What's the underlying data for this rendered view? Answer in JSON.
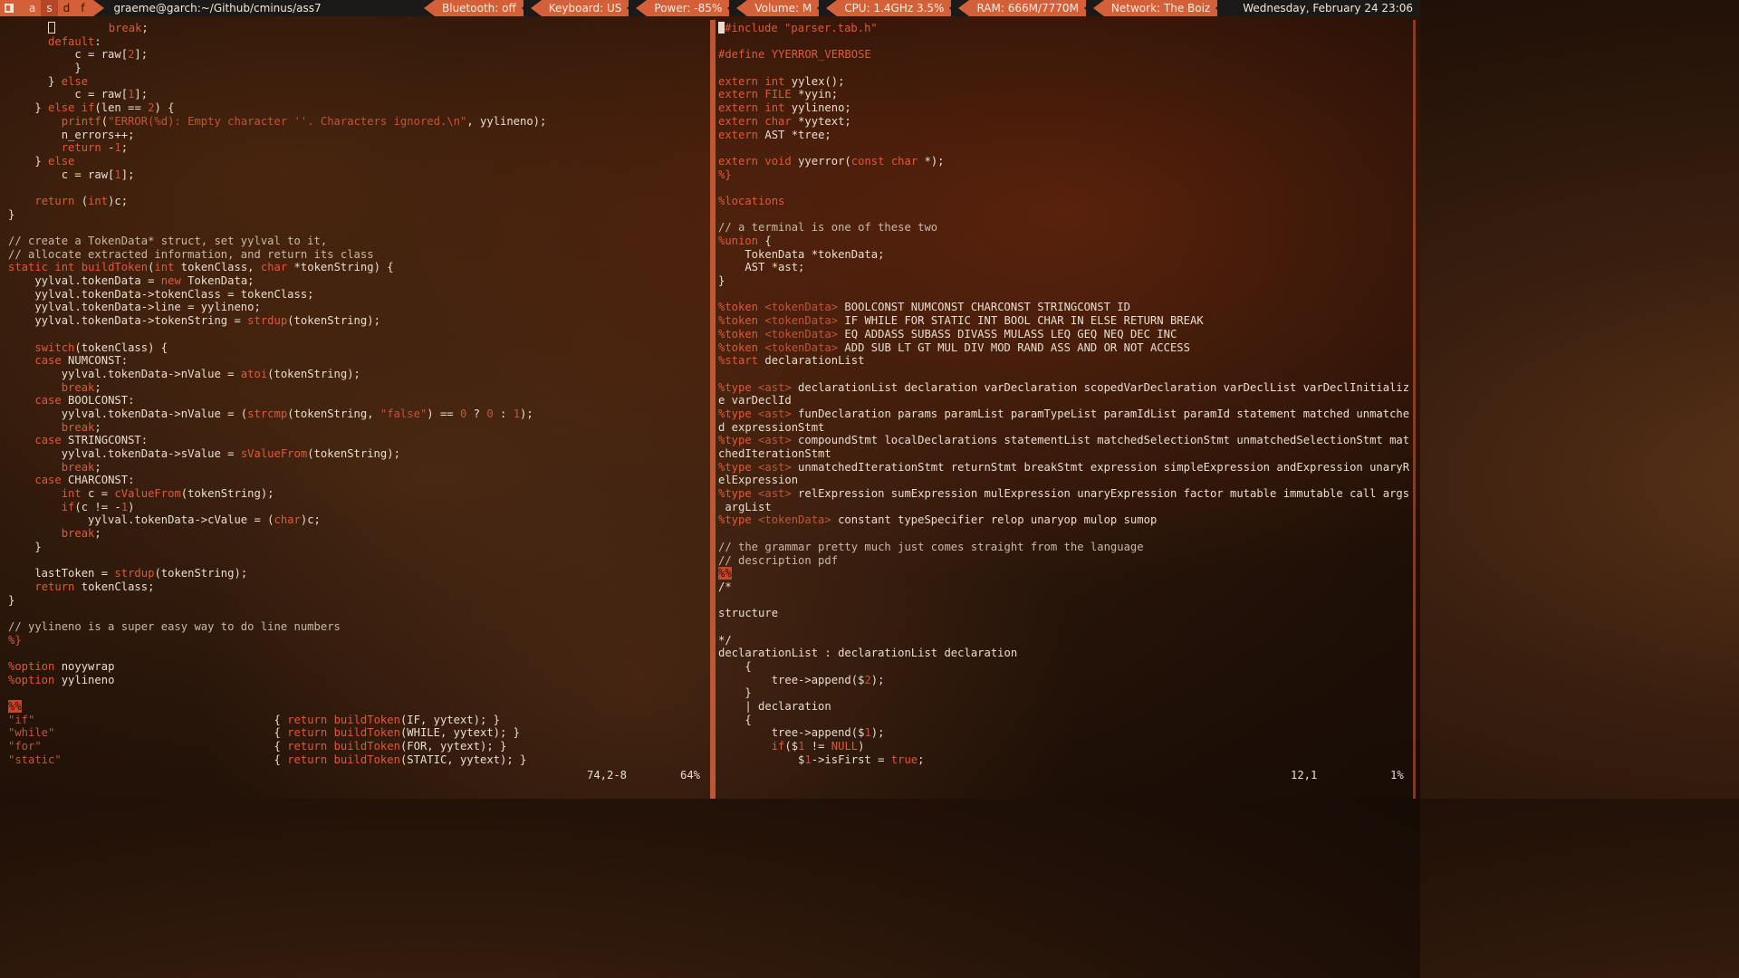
{
  "topbar": {
    "workspaces": [
      "a",
      "s",
      "d",
      "f"
    ],
    "window_title": "graeme@garch:~/Github/cminus/ass7",
    "bluetooth": "Bluetooth: off",
    "keyboard": "Keyboard: US",
    "power": "Power: -85%",
    "volume": "Volume: M",
    "cpu": "CPU: 1.4GHz 3.5%",
    "ram": "RAM: 666M/7770M",
    "network": "Network: The Boiz",
    "datetime": "Wednesday, February 24 23:06"
  },
  "accent_color": "#d4603a",
  "left_pane": {
    "lines": [
      "        break;",
      "      default:",
      "          c = raw[2];",
      "          }",
      "      } else",
      "          c = raw[1];",
      "    } else if(len == 2) {",
      "        printf(\"ERROR(%d): Empty character ''. Characters ignored.\\n\", yylineno);",
      "        n_errors++;",
      "        return -1;",
      "    } else",
      "        c = raw[1];",
      "",
      "    return (int)c;",
      "}",
      "",
      "// create a TokenData* struct, set yylval to it,",
      "// allocate extracted information, and return its class",
      "static int buildToken(int tokenClass, char *tokenString) {",
      "    yylval.tokenData = new TokenData;",
      "    yylval.tokenData->tokenClass = tokenClass;",
      "    yylval.tokenData->line = yylineno;",
      "    yylval.tokenData->tokenString = strdup(tokenString);",
      "",
      "    switch(tokenClass) {",
      "    case NUMCONST:",
      "        yylval.tokenData->nValue = atoi(tokenString);",
      "        break;",
      "    case BOOLCONST:",
      "        yylval.tokenData->nValue = (strcmp(tokenString, \"false\") == 0 ? 0 : 1);",
      "        break;",
      "    case STRINGCONST:",
      "        yylval.tokenData->sValue = sValueFrom(tokenString);",
      "        break;",
      "    case CHARCONST:",
      "        int c = cValueFrom(tokenString);",
      "        if(c != -1)",
      "            yylval.tokenData->cValue = (char)c;",
      "        break;",
      "    }",
      "",
      "    lastToken = strdup(tokenString);",
      "    return tokenClass;",
      "}",
      "",
      "// yylineno is a super easy way to do line numbers",
      "%}",
      "",
      "%option noyywrap",
      "%option yylineno",
      "",
      "%%",
      "\"if\"                                    { return buildToken(IF, yytext); }",
      "\"while\"                                 { return buildToken(WHILE, yytext); }",
      "\"for\"                                   { return buildToken(FOR, yytext); }",
      "\"static\"                                { return buildToken(STATIC, yytext); }"
    ],
    "position": "74,2-8",
    "percent": "64%"
  },
  "right_pane": {
    "lines": [
      "#include \"parser.tab.h\"",
      "",
      "#define YYERROR_VERBOSE",
      "",
      "extern int yylex();",
      "extern FILE *yyin;",
      "extern int yylineno;",
      "extern char *yytext;",
      "extern AST *tree;",
      "",
      "extern void yyerror(const char *);",
      "%}",
      "",
      "%locations",
      "",
      "// a terminal is one of these two",
      "%union {",
      "    TokenData *tokenData;",
      "    AST *ast;",
      "}",
      "",
      "%token <tokenData> BOOLCONST NUMCONST CHARCONST STRINGCONST ID",
      "%token <tokenData> IF WHILE FOR STATIC INT BOOL CHAR IN ELSE RETURN BREAK",
      "%token <tokenData> EQ ADDASS SUBASS DIVASS MULASS LEQ GEQ NEQ DEC INC",
      "%token <tokenData> ADD SUB LT GT MUL DIV MOD RAND ASS AND OR NOT ACCESS",
      "%start declarationList",
      "",
      "%type <ast> declarationList declaration varDeclaration scopedVarDeclaration varDeclList varDeclInitializ",
      "e varDeclId",
      "%type <ast> funDeclaration params paramList paramTypeList paramIdList paramId statement matched unmatche",
      "d expressionStmt",
      "%type <ast> compoundStmt localDeclarations statementList matchedSelectionStmt unmatchedSelectionStmt mat",
      "chedIterationStmt",
      "%type <ast> unmatchedIterationStmt returnStmt breakStmt expression simpleExpression andExpression unaryR",
      "elExpression",
      "%type <ast> relExpression sumExpression mulExpression unaryExpression factor mutable immutable call args",
      " argList",
      "%type <tokenData> constant typeSpecifier relop unaryop mulop sumop",
      "",
      "// the grammar pretty much just comes straight from the language",
      "// description pdf",
      "%%",
      "/*",
      "",
      "structure",
      "",
      "*/",
      "declarationList : declarationList declaration",
      "    {",
      "        tree->append($2);",
      "    }",
      "    | declaration",
      "    {",
      "        tree->append($1);",
      "        if($1 != NULL)",
      "            $1->isFirst = true;"
    ],
    "position": "12,1",
    "percent": "1%"
  }
}
